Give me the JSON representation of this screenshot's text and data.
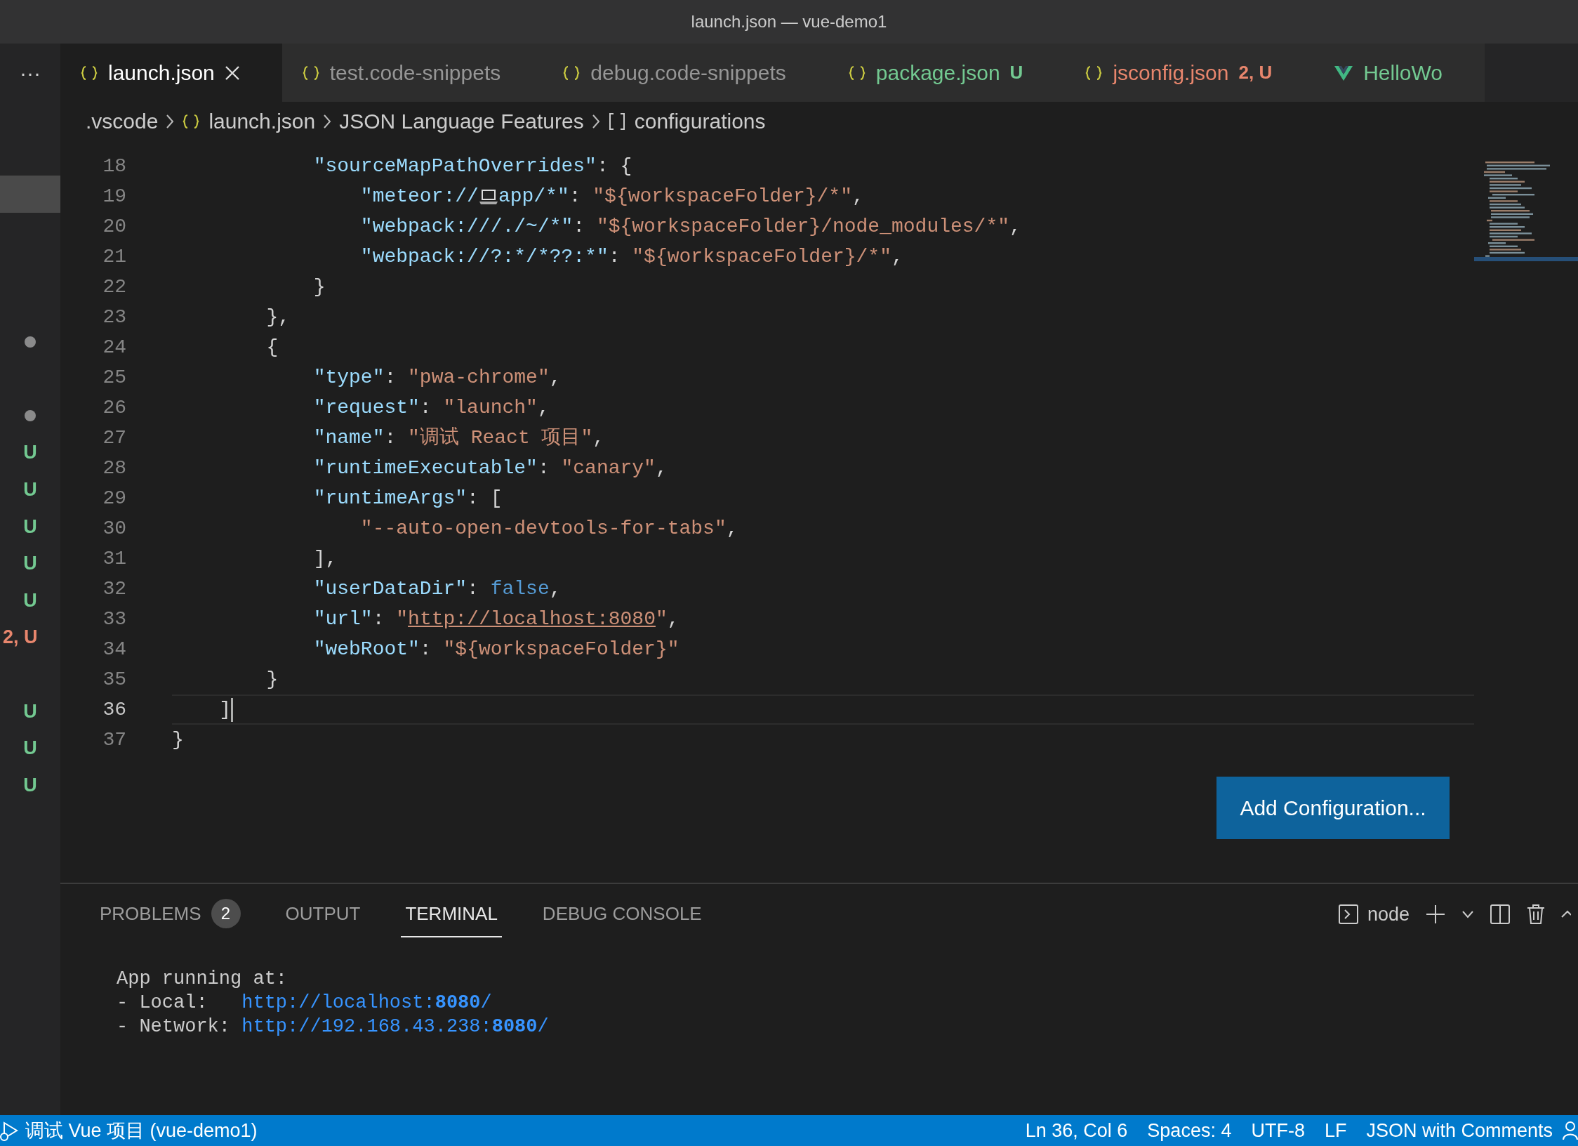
{
  "window": {
    "title": "launch.json — vue-demo1"
  },
  "sidebar": {
    "more": "···",
    "rows": [
      {
        "selected": false,
        "kind": "none"
      },
      {
        "selected": false,
        "kind": "none"
      },
      {
        "selected": true,
        "kind": "none"
      },
      {
        "selected": false,
        "kind": "none"
      },
      {
        "selected": false,
        "kind": "none"
      },
      {
        "selected": false,
        "kind": "none"
      },
      {
        "selected": false,
        "kind": "dot"
      },
      {
        "selected": false,
        "kind": "none"
      },
      {
        "selected": false,
        "kind": "dot"
      },
      {
        "selected": false,
        "kind": "status",
        "label": "U",
        "color": "#73c991"
      },
      {
        "selected": false,
        "kind": "status",
        "label": "U",
        "color": "#73c991"
      },
      {
        "selected": false,
        "kind": "status",
        "label": "U",
        "color": "#73c991"
      },
      {
        "selected": false,
        "kind": "status",
        "label": "U",
        "color": "#73c991"
      },
      {
        "selected": false,
        "kind": "status",
        "label": "U",
        "color": "#73c991"
      },
      {
        "selected": false,
        "kind": "status",
        "label": "2, U",
        "color": "#e8866d"
      },
      {
        "selected": false,
        "kind": "none"
      },
      {
        "selected": false,
        "kind": "status",
        "label": "U",
        "color": "#73c991"
      },
      {
        "selected": false,
        "kind": "status",
        "label": "U",
        "color": "#73c991"
      },
      {
        "selected": false,
        "kind": "status",
        "label": "U",
        "color": "#73c991"
      }
    ]
  },
  "tabs": [
    {
      "label": "launch.json",
      "kind": "json",
      "selected": true,
      "closable": true
    },
    {
      "label": "test.code-snippets",
      "kind": "json",
      "selected": false,
      "closable": false
    },
    {
      "label": "debug.code-snippets",
      "kind": "json",
      "selected": false,
      "closable": false
    },
    {
      "label": "package.json",
      "kind": "json",
      "selected": false,
      "closable": false,
      "color": "#73c991",
      "decoration": "U"
    },
    {
      "label": "jsconfig.json",
      "kind": "json",
      "selected": false,
      "closable": false,
      "color": "#e8866d",
      "decoration": "2, U"
    },
    {
      "label": "HelloWo",
      "kind": "vue",
      "selected": false,
      "closable": false,
      "color": "#73c991"
    }
  ],
  "breadcrumbs": [
    {
      "label": ".vscode",
      "kind": "plain"
    },
    {
      "label": "launch.json",
      "kind": "json"
    },
    {
      "label": "JSON Language Features",
      "kind": "plain"
    },
    {
      "label": "configurations",
      "kind": "array"
    }
  ],
  "editor": {
    "lines": [
      {
        "number": "18",
        "current": false,
        "tokens": [
          {
            "kind": "key",
            "text": "            \"sourceMapPathOverrides\""
          },
          {
            "kind": "punct",
            "text": ": {"
          }
        ]
      },
      {
        "number": "19",
        "current": false,
        "tokens": [
          {
            "kind": "key",
            "text": "                \"meteor://"
          },
          {
            "kind": "laptop-icon"
          },
          {
            "kind": "key",
            "text": "app/*\""
          },
          {
            "kind": "punct",
            "text": ": "
          },
          {
            "kind": "string",
            "text": "\"${workspaceFolder}/*\""
          },
          {
            "kind": "punct",
            "text": ","
          }
        ]
      },
      {
        "number": "20",
        "current": false,
        "tokens": [
          {
            "kind": "key",
            "text": "                \"webpack:///./~/*\""
          },
          {
            "kind": "punct",
            "text": ": "
          },
          {
            "kind": "string",
            "text": "\"${workspaceFolder}/node_modules/*\""
          },
          {
            "kind": "punct",
            "text": ","
          }
        ]
      },
      {
        "number": "21",
        "current": false,
        "tokens": [
          {
            "kind": "key",
            "text": "                \"webpack://?:*/*??:*\""
          },
          {
            "kind": "punct",
            "text": ": "
          },
          {
            "kind": "string",
            "text": "\"${workspaceFolder}/*\""
          },
          {
            "kind": "punct",
            "text": ","
          }
        ]
      },
      {
        "number": "22",
        "current": false,
        "tokens": [
          {
            "kind": "punct",
            "text": "            }"
          }
        ]
      },
      {
        "number": "23",
        "current": false,
        "tokens": [
          {
            "kind": "punct",
            "text": "        },"
          }
        ]
      },
      {
        "number": "24",
        "current": false,
        "tokens": [
          {
            "kind": "punct",
            "text": "        {"
          }
        ]
      },
      {
        "number": "25",
        "current": false,
        "tokens": [
          {
            "kind": "key",
            "text": "            \"type\""
          },
          {
            "kind": "punct",
            "text": ": "
          },
          {
            "kind": "string",
            "text": "\"pwa-chrome\""
          },
          {
            "kind": "punct",
            "text": ","
          }
        ]
      },
      {
        "number": "26",
        "current": false,
        "tokens": [
          {
            "kind": "key",
            "text": "            \"request\""
          },
          {
            "kind": "punct",
            "text": ": "
          },
          {
            "kind": "string",
            "text": "\"launch\""
          },
          {
            "kind": "punct",
            "text": ","
          }
        ]
      },
      {
        "number": "27",
        "current": false,
        "tokens": [
          {
            "kind": "key",
            "text": "            \"name\""
          },
          {
            "kind": "punct",
            "text": ": "
          },
          {
            "kind": "string",
            "text": "\"调试 React 项目\""
          },
          {
            "kind": "punct",
            "text": ","
          }
        ]
      },
      {
        "number": "28",
        "current": false,
        "tokens": [
          {
            "kind": "key",
            "text": "            \"runtimeExecutable\""
          },
          {
            "kind": "punct",
            "text": ": "
          },
          {
            "kind": "string",
            "text": "\"canary\""
          },
          {
            "kind": "punct",
            "text": ","
          }
        ]
      },
      {
        "number": "29",
        "current": false,
        "tokens": [
          {
            "kind": "key",
            "text": "            \"runtimeArgs\""
          },
          {
            "kind": "punct",
            "text": ": ["
          }
        ]
      },
      {
        "number": "30",
        "current": false,
        "tokens": [
          {
            "kind": "string",
            "text": "                \"--auto-open-devtools-for-tabs\""
          },
          {
            "kind": "punct",
            "text": ","
          }
        ]
      },
      {
        "number": "31",
        "current": false,
        "tokens": [
          {
            "kind": "punct",
            "text": "            ],"
          }
        ]
      },
      {
        "number": "32",
        "current": false,
        "tokens": [
          {
            "kind": "key",
            "text": "            \"userDataDir\""
          },
          {
            "kind": "punct",
            "text": ": "
          },
          {
            "kind": "bool",
            "text": "false"
          },
          {
            "kind": "punct",
            "text": ","
          }
        ]
      },
      {
        "number": "33",
        "current": false,
        "tokens": [
          {
            "kind": "key",
            "text": "            \"url\""
          },
          {
            "kind": "punct",
            "text": ": "
          },
          {
            "kind": "string",
            "text": "\""
          },
          {
            "kind": "link",
            "text": "http://localhost:8080"
          },
          {
            "kind": "string",
            "text": "\""
          },
          {
            "kind": "punct",
            "text": ","
          }
        ]
      },
      {
        "number": "34",
        "current": false,
        "tokens": [
          {
            "kind": "key",
            "text": "            \"webRoot\""
          },
          {
            "kind": "punct",
            "text": ": "
          },
          {
            "kind": "string",
            "text": "\"${workspaceFolder}\""
          }
        ]
      },
      {
        "number": "35",
        "current": false,
        "tokens": [
          {
            "kind": "punct",
            "text": "        }"
          }
        ]
      },
      {
        "number": "36",
        "current": true,
        "tokens": [
          {
            "kind": "punct",
            "text": "    ]"
          }
        ]
      },
      {
        "number": "37",
        "current": false,
        "tokens": [
          {
            "kind": "punct",
            "text": "}"
          }
        ]
      }
    ]
  },
  "add_configuration_button": "Add Configuration...",
  "panel": {
    "tabs": [
      {
        "label": "PROBLEMS",
        "count": "2",
        "selected": false
      },
      {
        "label": "OUTPUT",
        "selected": false
      },
      {
        "label": "TERMINAL",
        "selected": true
      },
      {
        "label": "DEBUG CONSOLE",
        "selected": false
      }
    ],
    "terminal_selector": "node",
    "terminal": {
      "lines": [
        [
          {
            "kind": "plain",
            "text": "App running at:"
          }
        ],
        [
          {
            "kind": "plain",
            "text": "- Local:   "
          },
          {
            "kind": "link",
            "text": "http://localhost:**8080**/"
          }
        ],
        [
          {
            "kind": "plain",
            "text": "- Network: "
          },
          {
            "kind": "link",
            "text": "http://192.168.43.238:**8080**/"
          }
        ]
      ]
    }
  },
  "status_bar": {
    "left": "调试 Vue 项目 (vue-demo1)",
    "right": [
      "Ln 36, Col 6",
      "Spaces: 4",
      "UTF-8",
      "LF",
      "JSON with Comments"
    ]
  }
}
